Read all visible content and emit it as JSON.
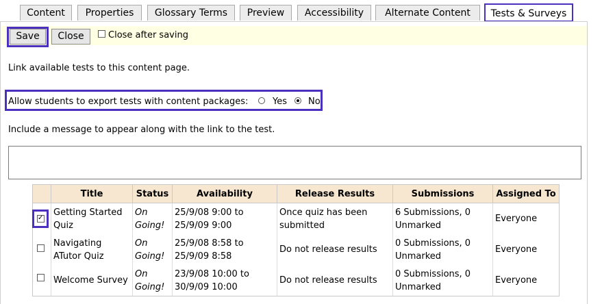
{
  "tabs": [
    {
      "label": "Content"
    },
    {
      "label": "Properties"
    },
    {
      "label": "Glossary Terms"
    },
    {
      "label": "Preview"
    },
    {
      "label": "Accessibility"
    },
    {
      "label": "Alternate Content"
    },
    {
      "label": "Tests & Surveys",
      "active": true
    }
  ],
  "toolbar": {
    "save_label": "Save",
    "close_label": "Close",
    "close_after_saving_label": "Close after saving",
    "close_after_saving_checked": false
  },
  "intro_text": "Link available tests to this content page.",
  "export": {
    "label": "Allow students to export tests with content packages:",
    "yes_label": "Yes",
    "no_label": "No",
    "selected": "No"
  },
  "message": {
    "label": "Include a message to appear along with the link to the test.",
    "value": ""
  },
  "table": {
    "headers": [
      "Title",
      "Status",
      "Availability",
      "Release Results",
      "Submissions",
      "Assigned To"
    ],
    "rows": [
      {
        "checked": true,
        "title_1": "Getting Started",
        "title_2": "Quiz",
        "status_1": "On",
        "status_2": "Going!",
        "avail_1": "25/9/08 9:00 to",
        "avail_2": "25/9/09 9:00",
        "release_1": "Once quiz has been",
        "release_2": "submitted",
        "subs_1": "6 Submissions, 0",
        "subs_2": "Unmarked",
        "assigned": "Everyone"
      },
      {
        "checked": false,
        "title_1": "Navigating",
        "title_2": "ATutor Quiz",
        "status_1": "On",
        "status_2": "Going!",
        "avail_1": "25/9/08 8:58 to",
        "avail_2": "25/9/09 8:58",
        "release_1": "Do not release results",
        "release_2": "",
        "subs_1": "0 Submissions, 0",
        "subs_2": "Unmarked",
        "assigned": "Everyone"
      },
      {
        "checked": false,
        "title_1": "Welcome Survey",
        "title_2": "",
        "status_1": "On",
        "status_2": "Going!",
        "avail_1": "23/9/08 10:00 to",
        "avail_2": "30/9/09 10:00",
        "release_1": "Do not release results",
        "release_2": "",
        "subs_1": "0 Submissions, 0",
        "subs_2": "Unmarked",
        "assigned": "Everyone"
      }
    ]
  },
  "colors": {
    "highlight": "#4b2fbf",
    "header_bg": "#f7e7d0",
    "savebar_bg": "#ffffe3"
  }
}
